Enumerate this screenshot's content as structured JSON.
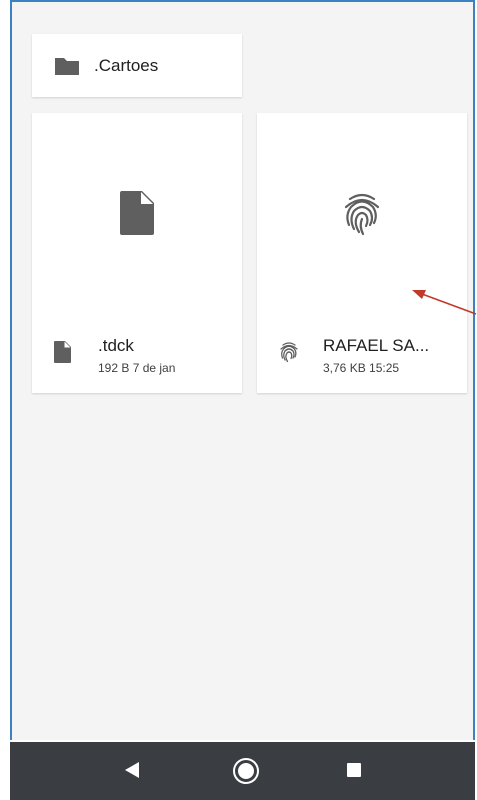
{
  "folder": {
    "name": ".Cartoes",
    "icon": "folder-icon"
  },
  "files": [
    {
      "name": ".tdck",
      "size": "192 B",
      "date": "7 de jan",
      "icon": "document-icon"
    },
    {
      "name": "RAFAEL SA...",
      "size": "3,76 KB",
      "date": "15:25",
      "icon": "fingerprint-icon"
    }
  ],
  "navbar": {
    "back_icon": "back-icon",
    "home_icon": "home-icon",
    "recents_icon": "recents-icon"
  },
  "colors": {
    "background": "#f4f4f4",
    "card": "#ffffff",
    "icon": "#5f5f5f",
    "navbar": "#3a3e42",
    "arrow": "#c0392b",
    "frame": "#3b82c4"
  }
}
